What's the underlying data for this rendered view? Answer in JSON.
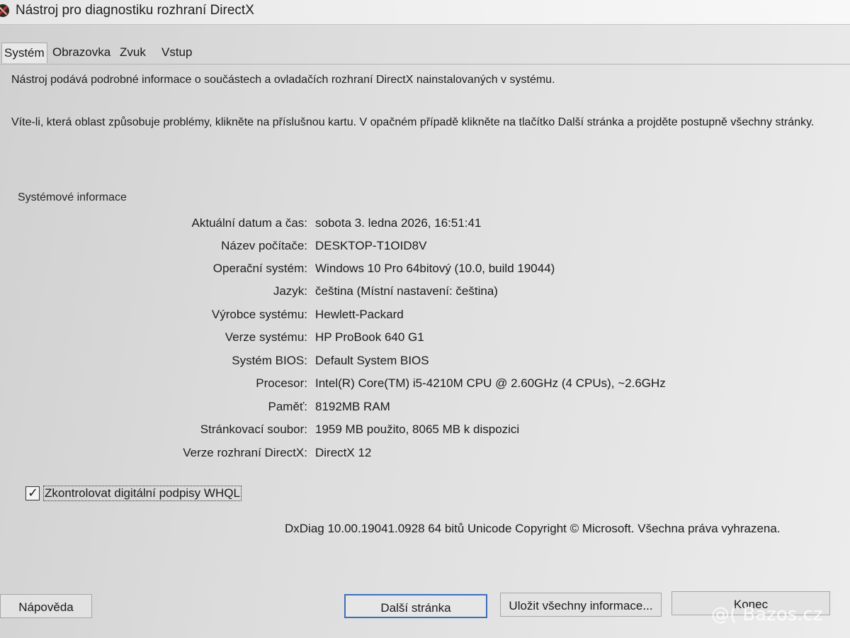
{
  "window": {
    "title": "Nástroj pro diagnostiku rozhraní DirectX"
  },
  "tabs": [
    {
      "label": "Systém",
      "active": true
    },
    {
      "label": "Obrazovka",
      "active": false
    },
    {
      "label": "Zvuk",
      "active": false
    },
    {
      "label": "Vstup",
      "active": false
    }
  ],
  "intro_text": "Nástroj podává podrobné informace o součástech a ovladačích rozhraní DirectX nainstalovaných v systému.",
  "hint_text": "Víte-li, která oblast způsobuje problémy, klikněte na příslušnou kartu. V opačném případě klikněte na tlačítko Další stránka a projděte postupně všechny stránky.",
  "system_info": {
    "group_title": "Systémové informace",
    "rows": [
      {
        "label": "Aktuální datum a čas:",
        "value": "sobota 3. ledna 2026, 16:51:41"
      },
      {
        "label": "Název počítače:",
        "value": "DESKTOP-T1OID8V"
      },
      {
        "label": "Operační systém:",
        "value": "Windows 10 Pro 64bitový (10.0, build 19044)"
      },
      {
        "label": "Jazyk:",
        "value": "čeština (Místní nastavení: čeština)"
      },
      {
        "label": "Výrobce systému:",
        "value": "Hewlett-Packard"
      },
      {
        "label": "Verze systému:",
        "value": "HP ProBook 640 G1"
      },
      {
        "label": "Systém BIOS:",
        "value": "Default System BIOS"
      },
      {
        "label": "Procesor:",
        "value": "Intel(R) Core(TM) i5-4210M CPU @ 2.60GHz (4 CPUs), ~2.6GHz"
      },
      {
        "label": "Paměť:",
        "value": "8192MB RAM"
      },
      {
        "label": "Stránkovací soubor:",
        "value": "1959 MB použito, 8065 MB k dispozici"
      },
      {
        "label": "Verze rozhraní DirectX:",
        "value": "DirectX 12"
      }
    ]
  },
  "whql": {
    "label": "Zkontrolovat digitální podpisy WHQL",
    "checked": true
  },
  "copyright": "DxDiag 10.00.19041.0928 64 bitů Unicode Copyright © Microsoft. Všechna práva vyhrazena.",
  "buttons": {
    "help": "Nápověda",
    "next": "Další stránka",
    "save": "Uložit všechny informace...",
    "exit": "Konec"
  },
  "watermark": "@( Bazos.cz",
  "colors": {
    "default_button_border": "#3d6fb8",
    "icon_accent": "#c0392b"
  },
  "icons": {
    "app": "directx-x-icon",
    "check": "checkmark-icon"
  }
}
